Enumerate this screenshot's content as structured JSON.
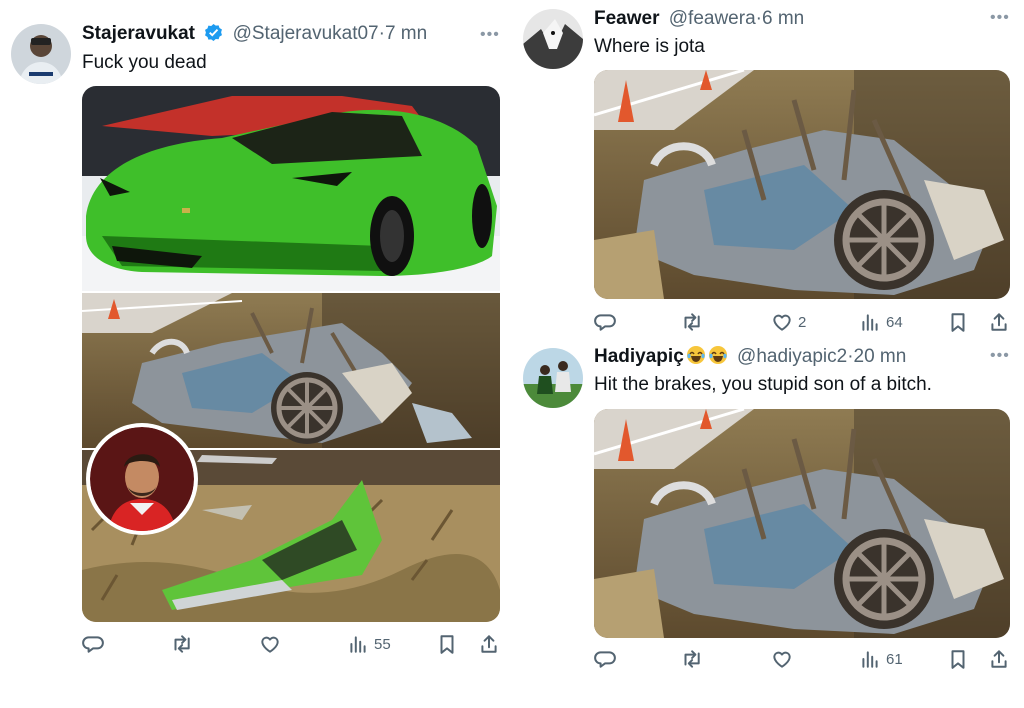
{
  "colors": {
    "text": "#0f1419",
    "muted": "#536471",
    "verified": "#1d9bf0"
  },
  "tweets": [
    {
      "name": "Stajeravukat",
      "verified": true,
      "handle": "@Stajeravukat07",
      "time": "7 mn",
      "text": "Fuck you dead",
      "stats": {
        "replies": "",
        "retweets": "",
        "likes": "",
        "views": "55"
      }
    },
    {
      "name": "Feawer",
      "handle": "@feawera",
      "time": "6 mn",
      "text": "Where is jota",
      "stats": {
        "replies": "",
        "retweets": "",
        "likes": "2",
        "views": "64"
      }
    },
    {
      "name": "Hadiyapiç",
      "name_emoji": [
        "😂",
        "😂"
      ],
      "handle": "@hadiyapic2",
      "time": "20 mn",
      "text": "Hit the brakes, you stupid son of a bitch.",
      "stats": {
        "replies": "",
        "retweets": "",
        "likes": "",
        "views": "61"
      }
    }
  ],
  "icons": [
    "reply-icon",
    "retweet-icon",
    "like-icon",
    "views-icon",
    "bookmark-icon",
    "share-icon",
    "more-icon",
    "verified-icon"
  ]
}
